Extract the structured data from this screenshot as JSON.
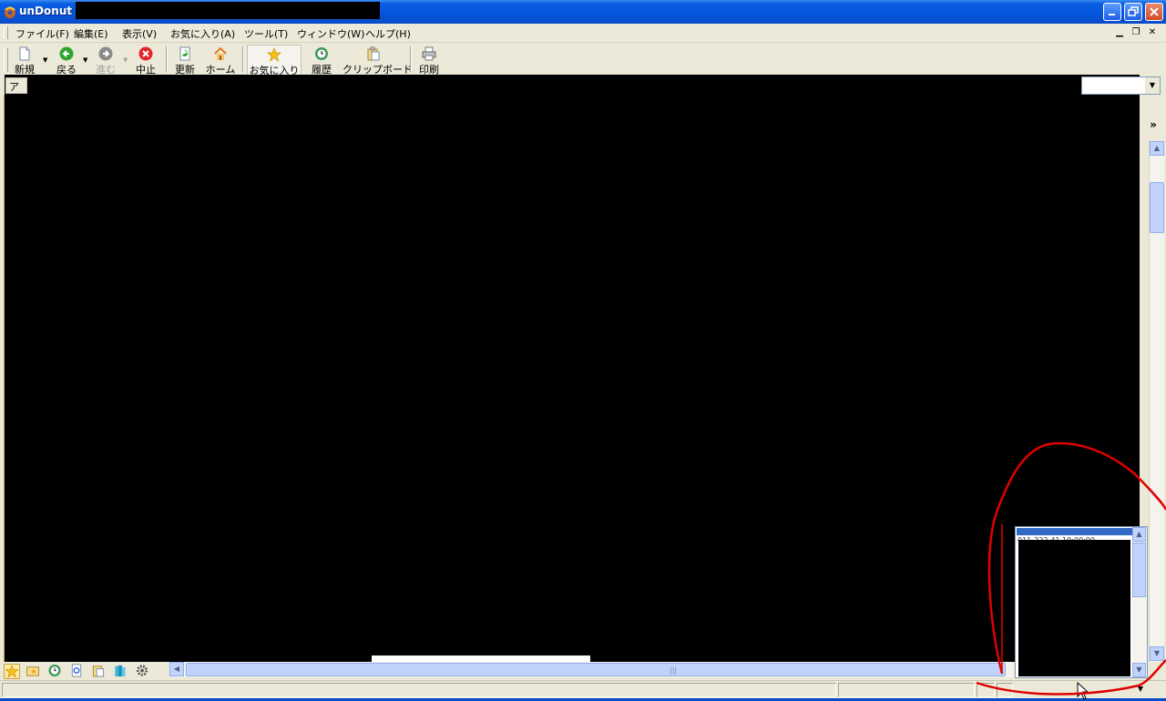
{
  "window": {
    "title": "unDonut"
  },
  "menubar": {
    "items": [
      {
        "label": "ファイル(F)"
      },
      {
        "label": "編集(E)"
      },
      {
        "label": "表示(V)"
      },
      {
        "label": "お気に入り(A)"
      },
      {
        "label": "ツール(T)"
      },
      {
        "label": "ウィンドウ(W)"
      },
      {
        "label": "ヘルプ(H)"
      }
    ]
  },
  "toolbar": {
    "new_label": "新規",
    "back_label": "戻る",
    "forward_label": "進む",
    "stop_label": "中止",
    "refresh_label": "更新",
    "home_label": "ホーム",
    "favorites_label": "お気に入り",
    "history_label": "履歴",
    "clipboard_label": "クリップボード",
    "print_label": "印刷"
  },
  "address": {
    "label": "アド"
  },
  "links": {
    "more": "»"
  },
  "popup": {
    "first_line": "011-222-41 19:00:00"
  },
  "colors": {
    "titlebar": "#0554db",
    "chrome": "#ece9d8",
    "annotation": "#e00000",
    "scroll_thumb": "#c1d3fb"
  },
  "icons": {
    "app": "donut-icon",
    "new": "new-page-icon",
    "back": "back-arrow-icon",
    "forward": "forward-arrow-icon",
    "stop": "stop-icon",
    "refresh": "refresh-icon",
    "home": "home-icon",
    "favorites": "star-icon",
    "history": "history-icon",
    "clipboard": "clipboard-icon",
    "print": "printer-icon"
  }
}
